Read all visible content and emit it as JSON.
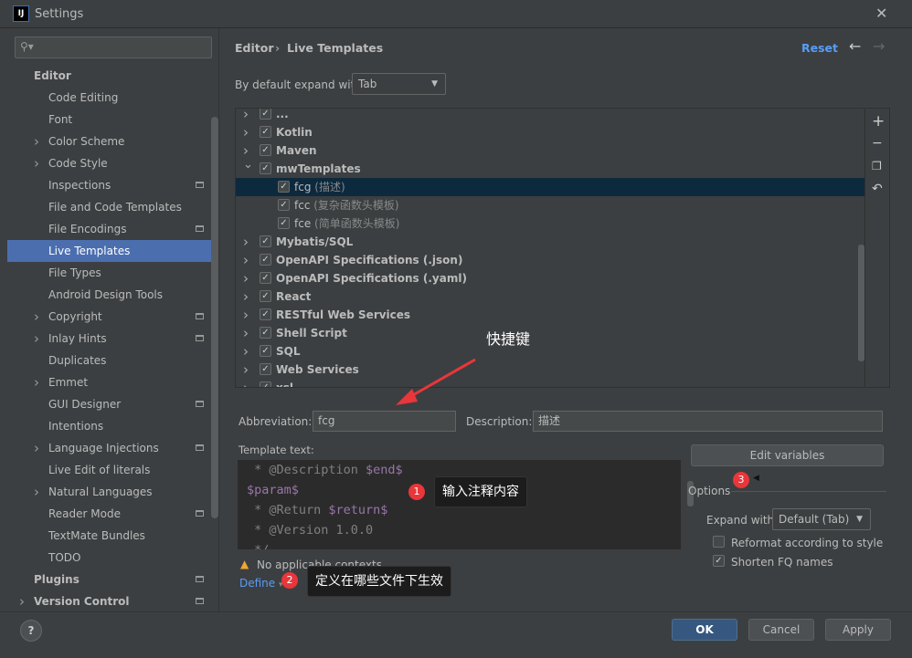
{
  "window": {
    "title": "Settings",
    "logo": "IJ",
    "close": "✕"
  },
  "sidebar": {
    "search_placeholder": "",
    "items": [
      {
        "label": "Editor",
        "level": 0,
        "bold": true
      },
      {
        "label": "Code Editing",
        "level": 1
      },
      {
        "label": "Font",
        "level": 1
      },
      {
        "label": "Color Scheme",
        "level": 1,
        "expandable": true
      },
      {
        "label": "Code Style",
        "level": 1,
        "expandable": true
      },
      {
        "label": "Inspections",
        "level": 1,
        "project": true
      },
      {
        "label": "File and Code Templates",
        "level": 1
      },
      {
        "label": "File Encodings",
        "level": 1,
        "project": true
      },
      {
        "label": "Live Templates",
        "level": 1,
        "selected": true
      },
      {
        "label": "File Types",
        "level": 1
      },
      {
        "label": "Android Design Tools",
        "level": 1
      },
      {
        "label": "Copyright",
        "level": 1,
        "expandable": true,
        "project": true
      },
      {
        "label": "Inlay Hints",
        "level": 1,
        "expandable": true,
        "project": true
      },
      {
        "label": "Duplicates",
        "level": 1
      },
      {
        "label": "Emmet",
        "level": 1,
        "expandable": true
      },
      {
        "label": "GUI Designer",
        "level": 1,
        "project": true
      },
      {
        "label": "Intentions",
        "level": 1
      },
      {
        "label": "Language Injections",
        "level": 1,
        "expandable": true,
        "project": true
      },
      {
        "label": "Live Edit of literals",
        "level": 1
      },
      {
        "label": "Natural Languages",
        "level": 1,
        "expandable": true
      },
      {
        "label": "Reader Mode",
        "level": 1,
        "project": true
      },
      {
        "label": "TextMate Bundles",
        "level": 1
      },
      {
        "label": "TODO",
        "level": 1
      },
      {
        "label": "Plugins",
        "level": 0,
        "bold": true,
        "project": true
      },
      {
        "label": "Version Control",
        "level": 0,
        "bold": true,
        "expandable": true,
        "project": true
      }
    ]
  },
  "header": {
    "breadcrumb": [
      "Editor",
      "Live Templates"
    ],
    "separator": "›",
    "reset": "Reset"
  },
  "expand": {
    "label": "By default expand with",
    "value": "Tab"
  },
  "tree": [
    {
      "label": "...",
      "type": "group",
      "expanded": false,
      "checked": true,
      "partial": true
    },
    {
      "label": "Kotlin",
      "type": "group",
      "expanded": false,
      "checked": true
    },
    {
      "label": "Maven",
      "type": "group",
      "expanded": false,
      "checked": true
    },
    {
      "label": "mwTemplates",
      "type": "group",
      "expanded": true,
      "checked": true
    },
    {
      "label": "fcg",
      "desc": "(描述)",
      "type": "item",
      "checked": true,
      "selected": true
    },
    {
      "label": "fcc",
      "desc": "(复杂函数头模板)",
      "type": "item",
      "checked": true
    },
    {
      "label": "fce",
      "desc": "(简单函数头模板)",
      "type": "item",
      "checked": true
    },
    {
      "label": "Mybatis/SQL",
      "type": "group",
      "expanded": false,
      "checked": true
    },
    {
      "label": "OpenAPI Specifications (.json)",
      "type": "group",
      "expanded": false,
      "checked": true
    },
    {
      "label": "OpenAPI Specifications (.yaml)",
      "type": "group",
      "expanded": false,
      "checked": true
    },
    {
      "label": "React",
      "type": "group",
      "expanded": false,
      "checked": true
    },
    {
      "label": "RESTful Web Services",
      "type": "group",
      "expanded": false,
      "checked": true
    },
    {
      "label": "Shell Script",
      "type": "group",
      "expanded": false,
      "checked": true
    },
    {
      "label": "SQL",
      "type": "group",
      "expanded": false,
      "checked": true
    },
    {
      "label": "Web Services",
      "type": "group",
      "expanded": false,
      "checked": true
    },
    {
      "label": "xsl",
      "type": "group",
      "expanded": false,
      "checked": true
    }
  ],
  "toolbar": {
    "add": "+",
    "remove": "−",
    "copy": "copy",
    "restore": "↶"
  },
  "form": {
    "abbreviation_label": "Abbreviation:",
    "abbreviation": "fcg",
    "description_label": "Description:",
    "description": "描述",
    "template_label": "Template text:",
    "template_lines": [
      [
        {
          "t": " * @Description ",
          "c": "gr"
        },
        {
          "t": "$end$",
          "c": "var"
        }
      ],
      [
        {
          "t": "$param$",
          "c": "var"
        }
      ],
      [
        {
          "t": " * @Return ",
          "c": "gr"
        },
        {
          "t": "$return$",
          "c": "var"
        }
      ],
      [
        {
          "t": " * @Version 1.0.0",
          "c": "gr"
        }
      ],
      [
        {
          "t": " */",
          "c": "gr"
        }
      ]
    ],
    "edit_variables": "Edit variables",
    "warning": "No applicable contexts.",
    "define": "Define"
  },
  "options": {
    "title": "Options",
    "expand_label": "Expand with",
    "expand_value": "Default (Tab)",
    "reformat": {
      "label": "Reformat according to style",
      "checked": false
    },
    "shorten": {
      "label": "Shorten FQ names",
      "checked": true
    }
  },
  "annotations": {
    "shortcut": "快捷键",
    "b1": "1",
    "t1": "输入注释内容",
    "b2": "2",
    "t2": "定义在哪些文件下生效",
    "b3": "3"
  },
  "buttons": {
    "help": "?",
    "ok": "OK",
    "cancel": "Cancel",
    "apply": "Apply"
  },
  "colors": {
    "accent": "#4b6eaf",
    "link": "#589df6",
    "badge": "#e8363a",
    "selection": "#0d293e",
    "arrow": "#e8363a"
  }
}
